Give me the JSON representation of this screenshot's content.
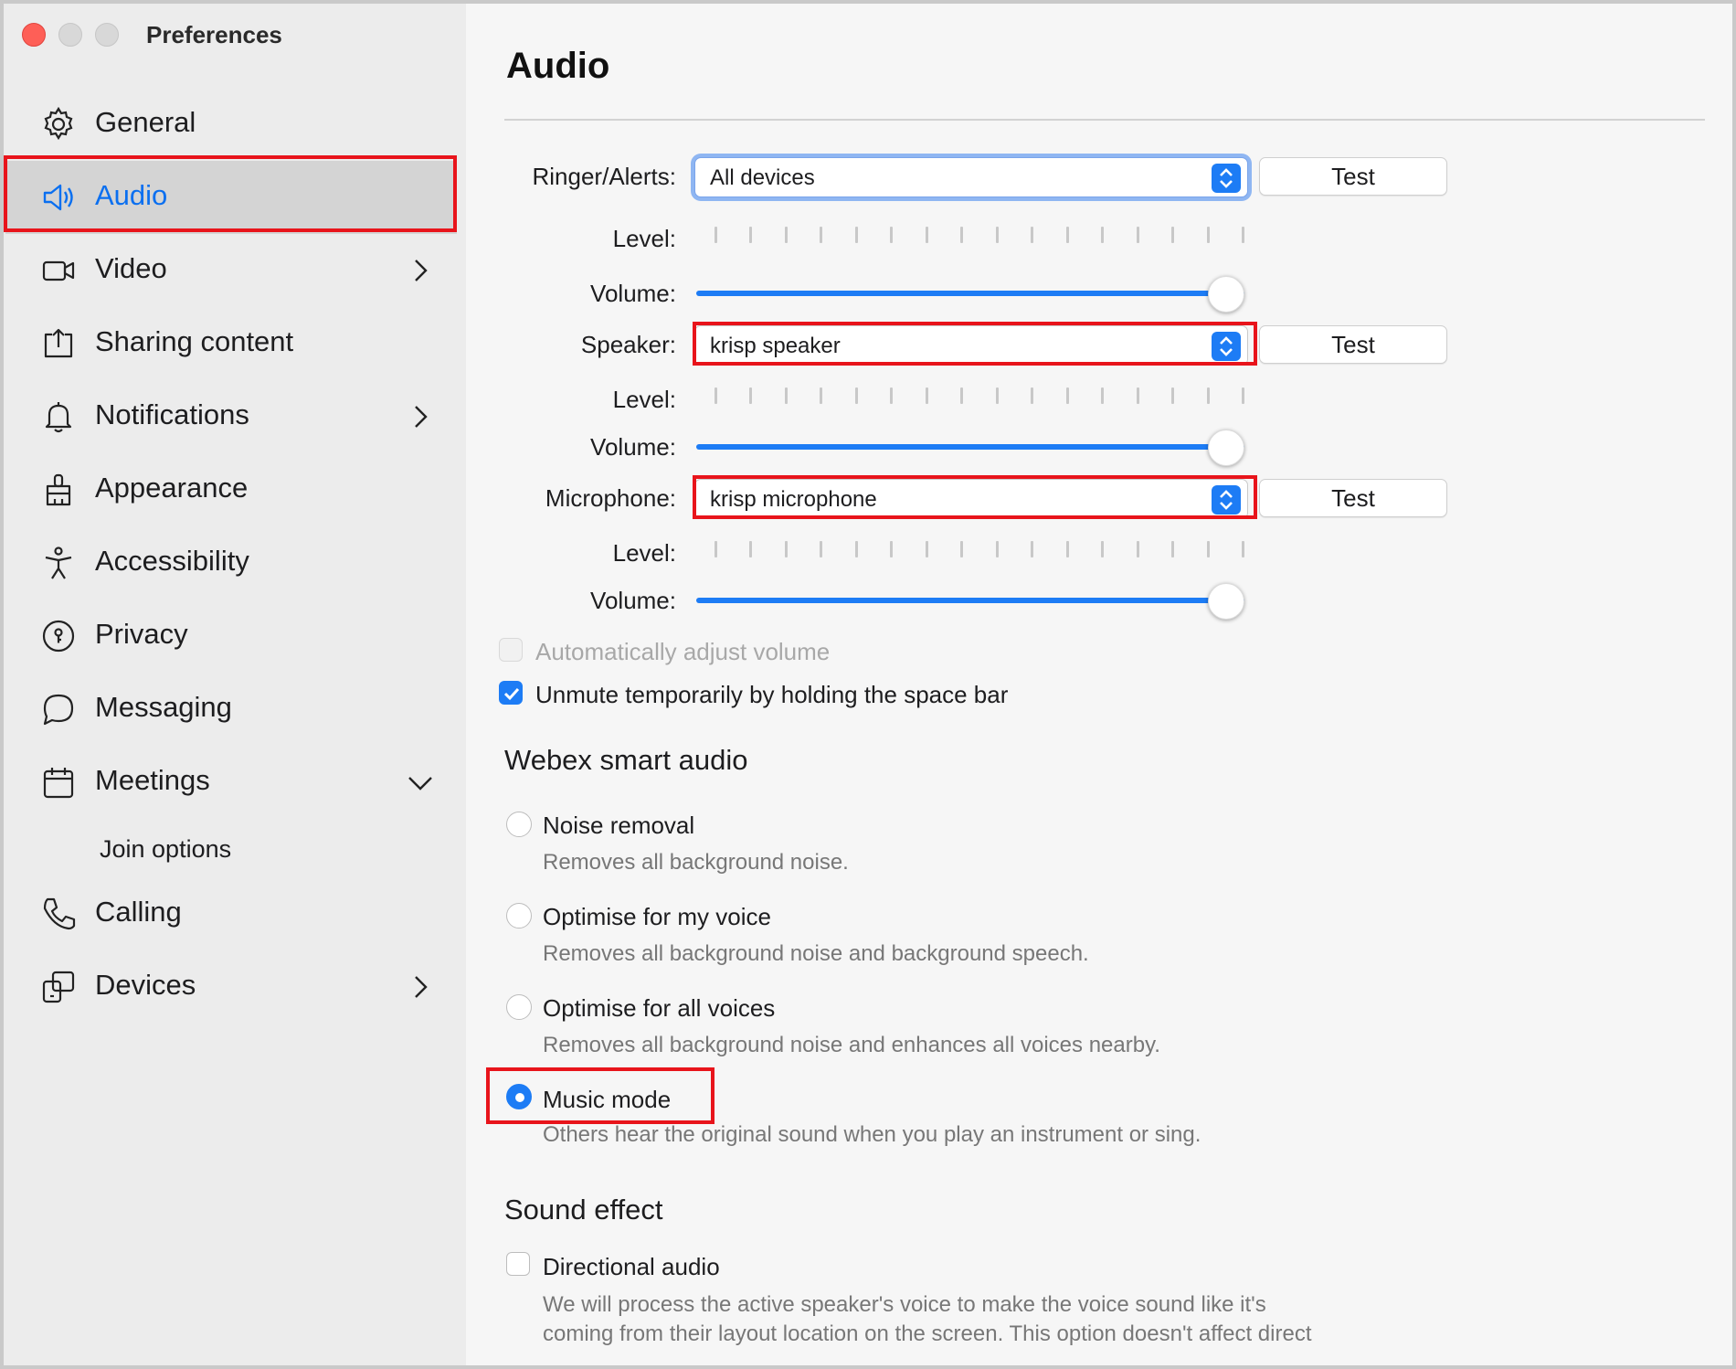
{
  "window": {
    "title": "Preferences"
  },
  "sidebar": {
    "items": [
      {
        "label": "General",
        "icon": "gear-icon"
      },
      {
        "label": "Audio",
        "icon": "speaker-icon",
        "active": true
      },
      {
        "label": "Video",
        "icon": "video-camera-icon",
        "chevron": "right"
      },
      {
        "label": "Sharing content",
        "icon": "share-upload-icon"
      },
      {
        "label": "Notifications",
        "icon": "bell-icon",
        "chevron": "right"
      },
      {
        "label": "Appearance",
        "icon": "paint-brush-icon"
      },
      {
        "label": "Accessibility",
        "icon": "accessibility-person-icon"
      },
      {
        "label": "Privacy",
        "icon": "privacy-lock-icon"
      },
      {
        "label": "Messaging",
        "icon": "chat-bubble-icon"
      },
      {
        "label": "Meetings",
        "icon": "calendar-icon",
        "chevron": "down"
      },
      {
        "label": "Calling",
        "icon": "phone-icon"
      },
      {
        "label": "Devices",
        "icon": "devices-icon",
        "chevron": "right"
      }
    ],
    "sub_items": [
      {
        "label": "Join options"
      }
    ]
  },
  "main": {
    "title": "Audio",
    "ringer": {
      "label": "Ringer/Alerts:",
      "value": "All devices",
      "test": "Test",
      "level_label": "Level:",
      "volume_label": "Volume:",
      "volume": 1.0
    },
    "speaker": {
      "label": "Speaker:",
      "value": "krisp speaker",
      "test": "Test",
      "level_label": "Level:",
      "volume_label": "Volume:",
      "volume": 1.0
    },
    "microphone": {
      "label": "Microphone:",
      "value": "krisp microphone",
      "test": "Test",
      "level_label": "Level:",
      "volume_label": "Volume:",
      "volume": 1.0
    },
    "auto_adjust": {
      "label": "Automatically adjust volume",
      "checked": false,
      "disabled": true
    },
    "unmute_space": {
      "label": "Unmute temporarily by holding the space bar",
      "checked": true
    },
    "smart_audio": {
      "heading": "Webex smart audio",
      "options": [
        {
          "title": "Noise removal",
          "desc": "Removes all background noise.",
          "selected": false
        },
        {
          "title": "Optimise for my voice",
          "desc": "Removes all background noise and background speech.",
          "selected": false
        },
        {
          "title": "Optimise for all voices",
          "desc": "Removes all background noise and enhances all voices nearby.",
          "selected": false
        },
        {
          "title": "Music mode",
          "desc": "Others hear the original sound when you play an instrument or sing.",
          "selected": true
        }
      ]
    },
    "sound_effect": {
      "heading": "Sound effect",
      "directional": {
        "title": "Directional audio",
        "checked": false,
        "desc_line1": "We will process the active speaker's voice to make the voice sound like it's",
        "desc_line2": "coming from their layout location on the screen. This option doesn't affect direct"
      }
    }
  },
  "colors": {
    "accent": "#1d7cf5",
    "highlight": "#e8141b",
    "sidebar_bg": "#ececec",
    "content_bg": "#f6f6f6"
  }
}
